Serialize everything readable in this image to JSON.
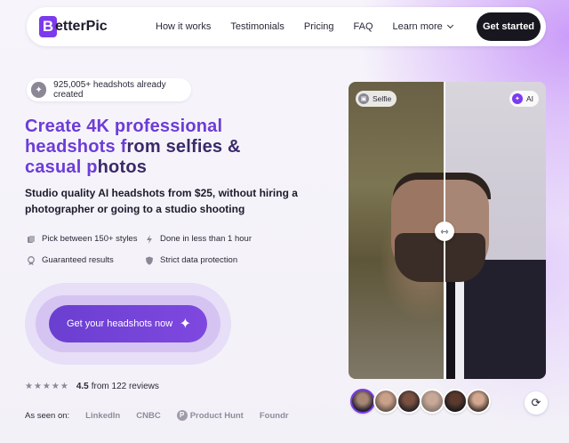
{
  "nav": {
    "logo_letter": "B",
    "logo_text": "etterPic",
    "links": [
      "How it works",
      "Testimonials",
      "Pricing",
      "FAQ"
    ],
    "learn_more": "Learn more",
    "cta": "Get started"
  },
  "badge": {
    "text": "925,005+ headshots already created"
  },
  "hero": {
    "title_line1": "Create 4K professional",
    "title_line2a": "headshots f",
    "title_line2b": "rom selfies &",
    "title_line3a": "casual p",
    "title_line3b": "hotos",
    "subtitle": "Studio quality AI headshots from $25, without hiring a photographer or going to a studio shooting"
  },
  "features": [
    "Pick between 150+ styles",
    "Done in less than 1 hour",
    "Guaranteed results",
    "Strict data protection"
  ],
  "cta_main": "Get your headshots now",
  "rating": {
    "stars": "★★★★★",
    "score": "4.5",
    "text": "from 122 reviews"
  },
  "seen_on": {
    "label": "As seen on:",
    "brands": [
      "LinkedIn",
      "CNBC",
      "Product Hunt",
      "Foundr"
    ]
  },
  "compare": {
    "left_tag": "Selfie",
    "right_tag": "AI"
  },
  "colors": {
    "accent": "#7c3aed",
    "dark": "#18161f"
  }
}
